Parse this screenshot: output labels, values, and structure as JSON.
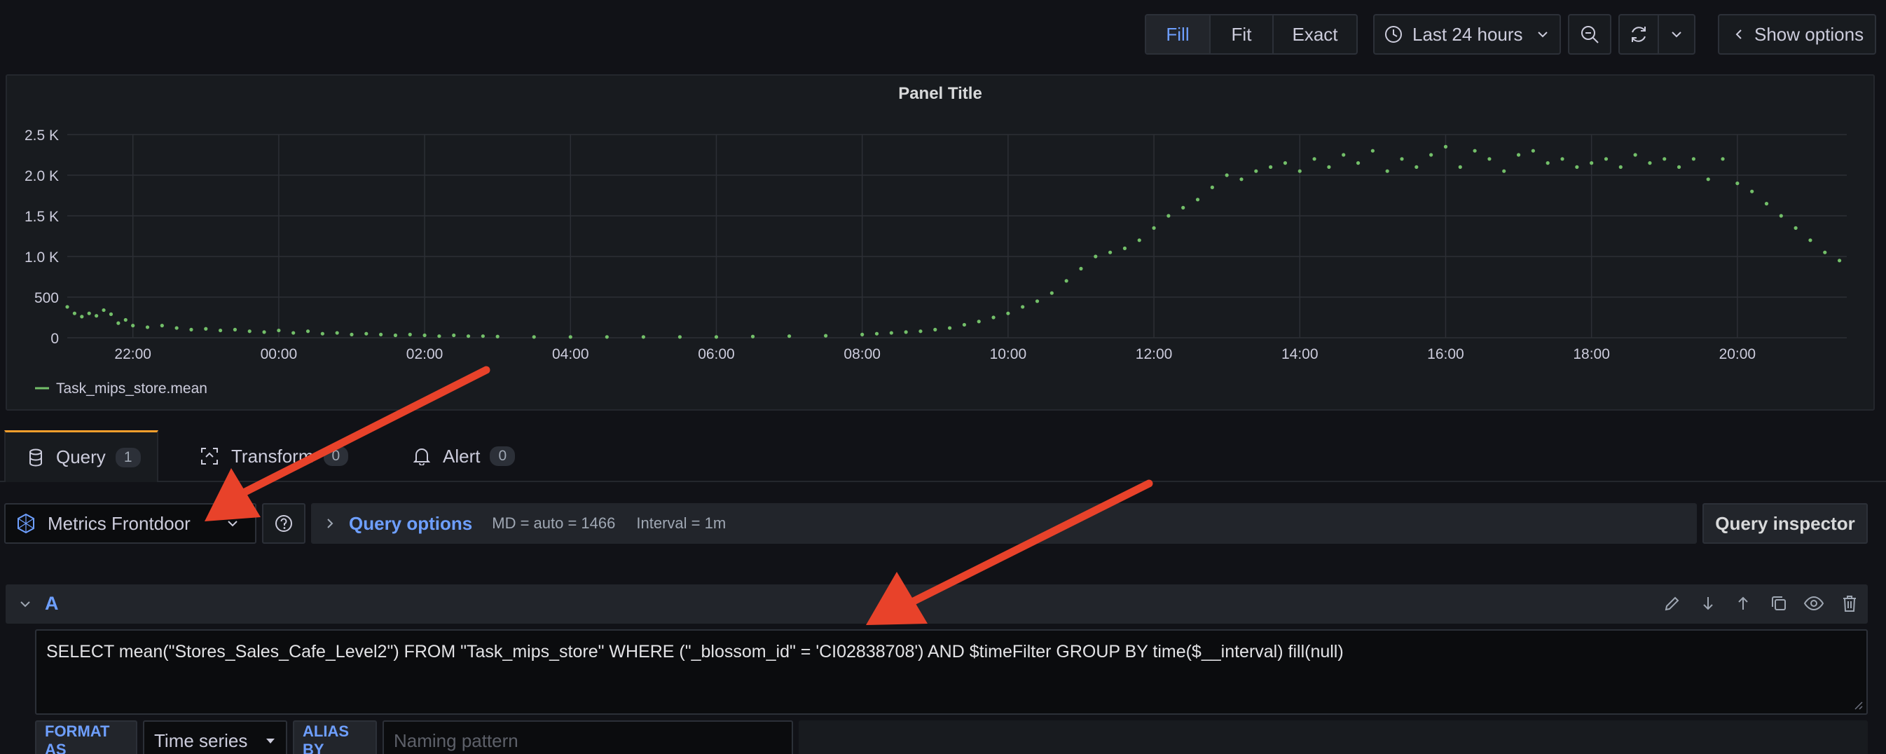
{
  "toolbar": {
    "fill_label": "Fill",
    "fit_label": "Fit",
    "exact_label": "Exact",
    "time_range": "Last 24 hours",
    "show_options": "Show options"
  },
  "panel": {
    "title": "Panel Title"
  },
  "chart_data": {
    "type": "scatter",
    "title": "Panel Title",
    "x_tick_labels": [
      "22:00",
      "00:00",
      "02:00",
      "04:00",
      "06:00",
      "08:00",
      "10:00",
      "12:00",
      "14:00",
      "16:00",
      "18:00",
      "20:00"
    ],
    "y_tick_labels": [
      "0",
      "500",
      "1.0 K",
      "1.5 K",
      "2.0 K",
      "2.5 K"
    ],
    "ylim": [
      0,
      2500
    ],
    "xlim_hours": [
      21.1,
      45.5
    ],
    "grid": true,
    "legend_position": "bottom-left",
    "color": "#73bf69",
    "series": [
      {
        "name": "Task_mips_store.mean",
        "x_hours": [
          21.1,
          21.2,
          21.3,
          21.4,
          21.5,
          21.6,
          21.7,
          21.8,
          21.9,
          22.0,
          22.2,
          22.4,
          22.6,
          22.8,
          23.0,
          23.2,
          23.4,
          23.6,
          23.8,
          24.0,
          24.2,
          24.4,
          24.6,
          24.8,
          25.0,
          25.2,
          25.4,
          25.6,
          25.8,
          26.0,
          26.2,
          26.4,
          26.6,
          26.8,
          27.0,
          27.5,
          28.0,
          28.5,
          29.0,
          29.5,
          30.0,
          30.5,
          31.0,
          31.5,
          32.0,
          32.2,
          32.4,
          32.6,
          32.8,
          33.0,
          33.2,
          33.4,
          33.6,
          33.8,
          34.0,
          34.2,
          34.4,
          34.6,
          34.8,
          35.0,
          35.2,
          35.4,
          35.6,
          35.8,
          36.0,
          36.2,
          36.4,
          36.6,
          36.8,
          37.0,
          37.2,
          37.4,
          37.6,
          37.8,
          38.0,
          38.2,
          38.4,
          38.6,
          38.8,
          39.0,
          39.2,
          39.4,
          39.6,
          39.8,
          40.0,
          40.2,
          40.4,
          40.6,
          40.8,
          41.0,
          41.2,
          41.4,
          41.6,
          41.8,
          42.0,
          42.2,
          42.4,
          42.6,
          42.8,
          43.0,
          43.2,
          43.4,
          43.6,
          43.8,
          44.0,
          44.2,
          44.4,
          44.6,
          44.8,
          45.0,
          45.2,
          45.4
        ],
        "y_values": [
          380,
          300,
          260,
          300,
          270,
          340,
          290,
          180,
          220,
          150,
          130,
          150,
          120,
          100,
          110,
          90,
          100,
          80,
          70,
          90,
          60,
          80,
          50,
          60,
          40,
          50,
          40,
          30,
          40,
          30,
          20,
          30,
          20,
          20,
          15,
          10,
          10,
          10,
          10,
          10,
          10,
          15,
          20,
          25,
          40,
          50,
          60,
          70,
          80,
          100,
          120,
          160,
          200,
          250,
          300,
          380,
          450,
          550,
          700,
          850,
          1000,
          1050,
          1100,
          1200,
          1350,
          1500,
          1600,
          1700,
          1850,
          2000,
          1950,
          2050,
          2100,
          2150,
          2050,
          2200,
          2100,
          2250,
          2150,
          2300,
          2050,
          2200,
          2100,
          2250,
          2350,
          2100,
          2300,
          2200,
          2050,
          2250,
          2300,
          2150,
          2200,
          2100,
          2150,
          2200,
          2100,
          2250,
          2150,
          2200,
          2100,
          2200,
          1950,
          2200,
          1900,
          1800,
          1650,
          1500,
          1350,
          1200,
          1050,
          950
        ]
      }
    ]
  },
  "tabs": [
    {
      "label": "Query",
      "count": "1"
    },
    {
      "label": "Transform",
      "count": "0"
    },
    {
      "label": "Alert",
      "count": "0"
    }
  ],
  "editor": {
    "datasource": "Metrics Frontdoor",
    "query_options_label": "Query options",
    "md_text": "MD = auto = 1466",
    "interval_text": "Interval = 1m",
    "query_inspector": "Query inspector",
    "query_ref": "A",
    "query_text": "SELECT mean(\"Stores_Sales_Cafe_Level2\") FROM \"Task_mips_store\" WHERE (\"_blossom_id\" = 'CI02838708') AND $timeFilter GROUP BY time($__interval) fill(null)",
    "format_as_label": "FORMAT AS",
    "format_value": "Time series",
    "alias_by_label": "ALIAS BY",
    "alias_placeholder": "Naming pattern"
  }
}
